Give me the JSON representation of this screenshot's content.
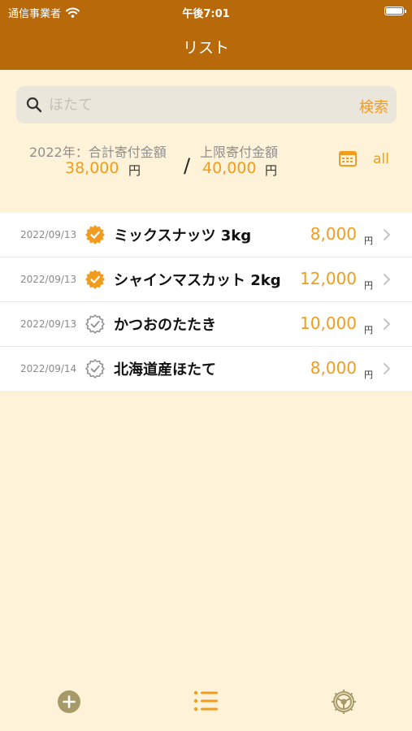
{
  "status_bar": {
    "carrier": "通信事業者",
    "time": "午後7:01"
  },
  "nav": {
    "title": "リスト"
  },
  "search": {
    "placeholder": "ほたて",
    "button_label": "検索"
  },
  "summary": {
    "year_label": "2022年：合計寄付金額",
    "total_value": "38,000",
    "total_unit": "円",
    "separator": "/",
    "limit_label": "上限寄付金額",
    "limit_value": "40,000",
    "limit_unit": "円",
    "all_label": "all"
  },
  "items": [
    {
      "date": "2022/09/13",
      "name": "ミックスナッツ 3kg",
      "amount": "8,000",
      "unit": "円",
      "checked": true
    },
    {
      "date": "2022/09/13",
      "name": "シャインマスカット 2kg",
      "amount": "12,000",
      "unit": "円",
      "checked": true
    },
    {
      "date": "2022/09/13",
      "name": "かつおのたたき",
      "amount": "10,000",
      "unit": "円",
      "checked": false
    },
    {
      "date": "2022/09/14",
      "name": "北海道産ほたて",
      "amount": "8,000",
      "unit": "円",
      "checked": false
    }
  ],
  "icons": {
    "search": "search-icon",
    "calendar": "calendar-icon",
    "add": "plus-circle-icon",
    "list": "list-icon",
    "settings": "gear-icon",
    "checked": "checkmark-seal-filled-icon",
    "unchecked": "checkmark-seal-outline-icon",
    "chevron": "chevron-right-icon",
    "wifi": "wifi-icon",
    "battery": "battery-icon"
  },
  "colors": {
    "header": "#b8690a",
    "background": "#fef3d9",
    "accent": "#f29c1f",
    "search_field": "#ebe6dc",
    "tab_icon_inactive": "#a89a68"
  }
}
